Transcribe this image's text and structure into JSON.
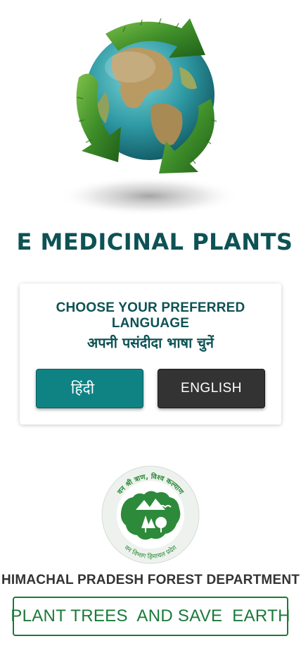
{
  "hero": {
    "image_icon": "recycling-globe-icon"
  },
  "app_title": "E MEDICINAL PLANTS",
  "language_card": {
    "heading_en": "CHOOSE YOUR PREFERRED LANGUAGE",
    "heading_hi": "अपनी पसंदीदा भाषा चुनें",
    "hindi_button": "हिंदी",
    "english_button": "ENGLISH"
  },
  "emblem": {
    "icon": "forest-department-emblem-icon",
    "top_text": "वन श्री त्राण, विश्व कल्याण",
    "bottom_text": "वन विभाग हिमाचल प्रदेश"
  },
  "department_name": "HIMACHAL PRADESH FOREST DEPARTMENT",
  "slogan": "PLANT TREES  AND SAVE  EARTH",
  "colors": {
    "primary_teal": "#0f8384",
    "title_teal": "#0d5254",
    "dark_button": "#333333",
    "slogan_green": "#1a7a3a"
  }
}
